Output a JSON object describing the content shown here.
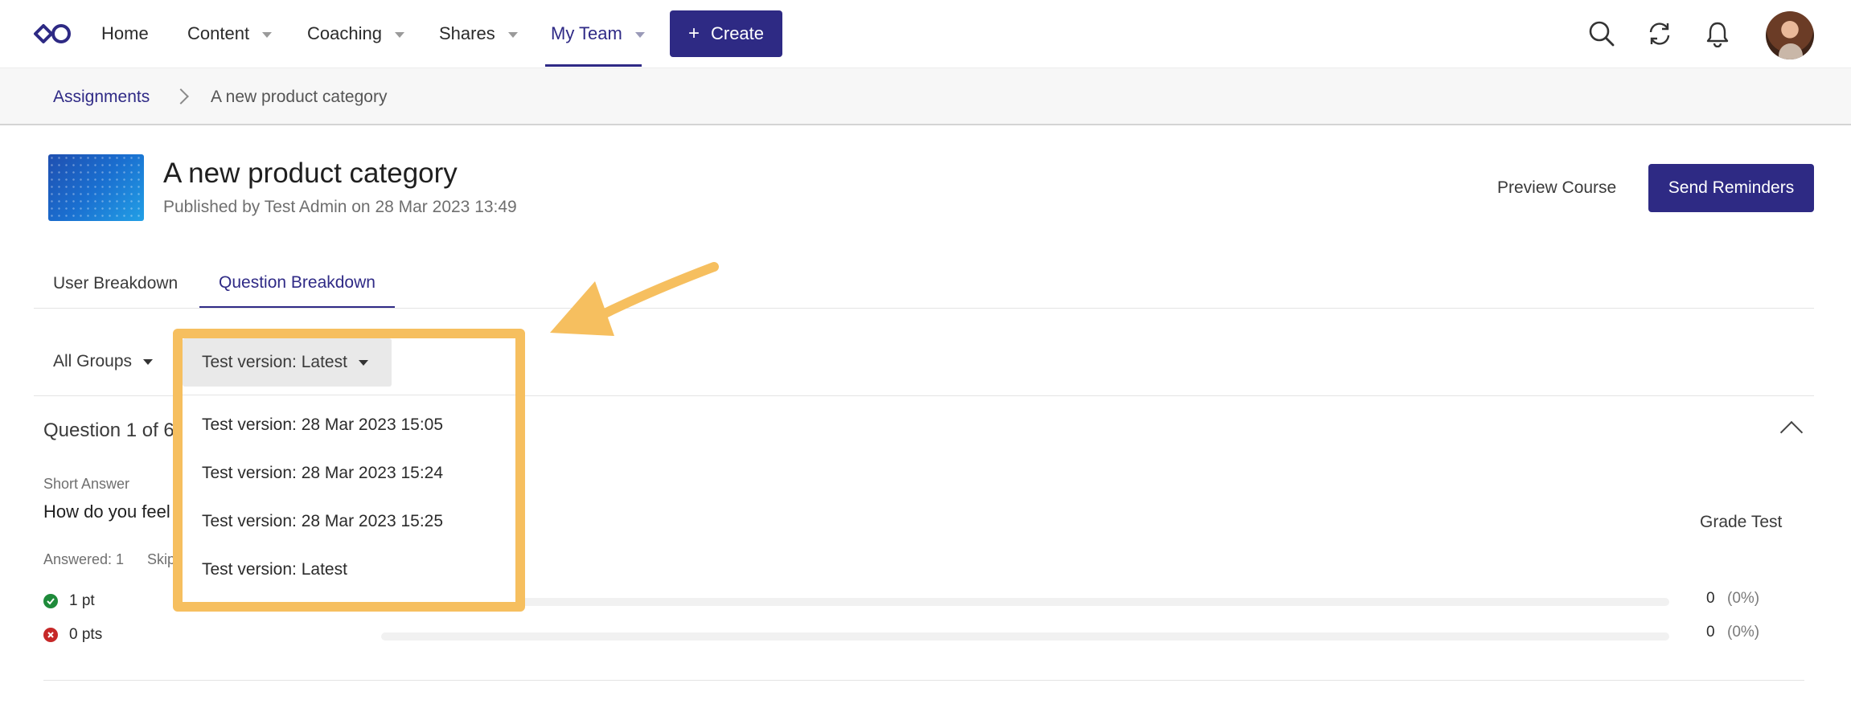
{
  "nav": {
    "items": [
      {
        "label": "Home",
        "has_caret": false
      },
      {
        "label": "Content",
        "has_caret": true
      },
      {
        "label": "Coaching",
        "has_caret": true
      },
      {
        "label": "Shares",
        "has_caret": true
      },
      {
        "label": "My Team",
        "has_caret": true,
        "active": true
      }
    ],
    "create_label": "Create",
    "icons": [
      "search-icon",
      "sync-icon",
      "bell-icon",
      "avatar"
    ],
    "accent_color": "#2e2a84"
  },
  "breadcrumb": {
    "parent": "Assignments",
    "current": "A new product category"
  },
  "course": {
    "title": "A new product category",
    "subtitle": "Published by Test Admin on 28 Mar 2023 13:49",
    "preview_label": "Preview Course",
    "send_label": "Send Reminders"
  },
  "tabs": [
    {
      "label": "User Breakdown",
      "active": false
    },
    {
      "label": "Question Breakdown",
      "active": true
    }
  ],
  "filters": {
    "groups_label": "All Groups",
    "version_label": "Test version: Latest",
    "version_options": [
      "Test version: 28 Mar 2023 15:05",
      "Test version: 28 Mar 2023 15:24",
      "Test version: 28 Mar 2023 15:25",
      "Test version: Latest"
    ]
  },
  "question": {
    "count_label": "Question 1 of 6",
    "type": "Short Answer",
    "text": "How do you feel",
    "grade_label": "Grade Test",
    "answered": "Answered: 1",
    "skipped": "Skip",
    "scores": [
      {
        "label": "1 pt",
        "status": "correct",
        "count": "0",
        "percent": "(0%)",
        "fraction": 0
      },
      {
        "label": "0 pts",
        "status": "incorrect",
        "count": "0",
        "percent": "(0%)",
        "fraction": 0
      }
    ]
  },
  "annotation": {
    "highlight_color": "#f6bf5f"
  }
}
